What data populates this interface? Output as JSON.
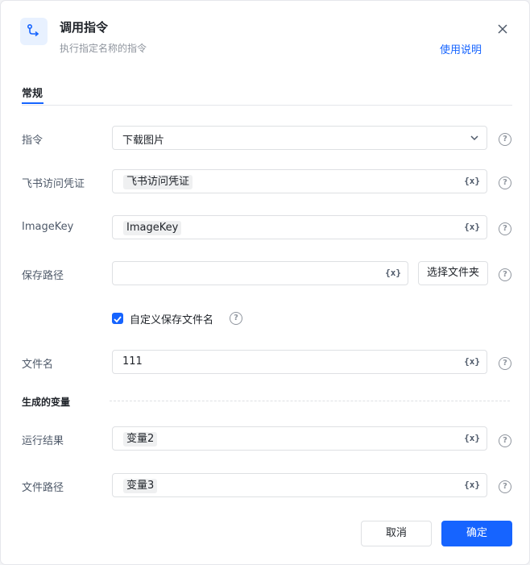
{
  "dialog": {
    "title": "调用指令",
    "subtitle": "执行指定名称的指令",
    "help_link": "使用说明",
    "icon": "flow-step-icon",
    "close_icon": "close-icon"
  },
  "tabs": [
    {
      "label": "常规",
      "active": true
    }
  ],
  "form": {
    "command": {
      "label": "指令",
      "value": "下载图片"
    },
    "credential": {
      "label": "飞书访问凭证",
      "chip": "飞书访问凭证"
    },
    "image_key": {
      "label": "ImageKey",
      "chip": "ImageKey"
    },
    "save_path": {
      "label": "保存路径",
      "value": "",
      "choose_button": "选择文件夹"
    },
    "custom_name": {
      "label": "自定义保存文件名",
      "checked": true
    },
    "file_name": {
      "label": "文件名",
      "value": "111"
    }
  },
  "variable_symbol": "{x}",
  "help_symbol": "?",
  "outputs": {
    "section_title": "生成的变量",
    "run_result": {
      "label": "运行结果",
      "chip": "变量2"
    },
    "file_path": {
      "label": "文件路径",
      "chip": "变量3"
    }
  },
  "footer": {
    "cancel": "取消",
    "confirm": "确定"
  },
  "colors": {
    "accent": "#1664ff",
    "icon_bg": "#e8f1ff"
  }
}
